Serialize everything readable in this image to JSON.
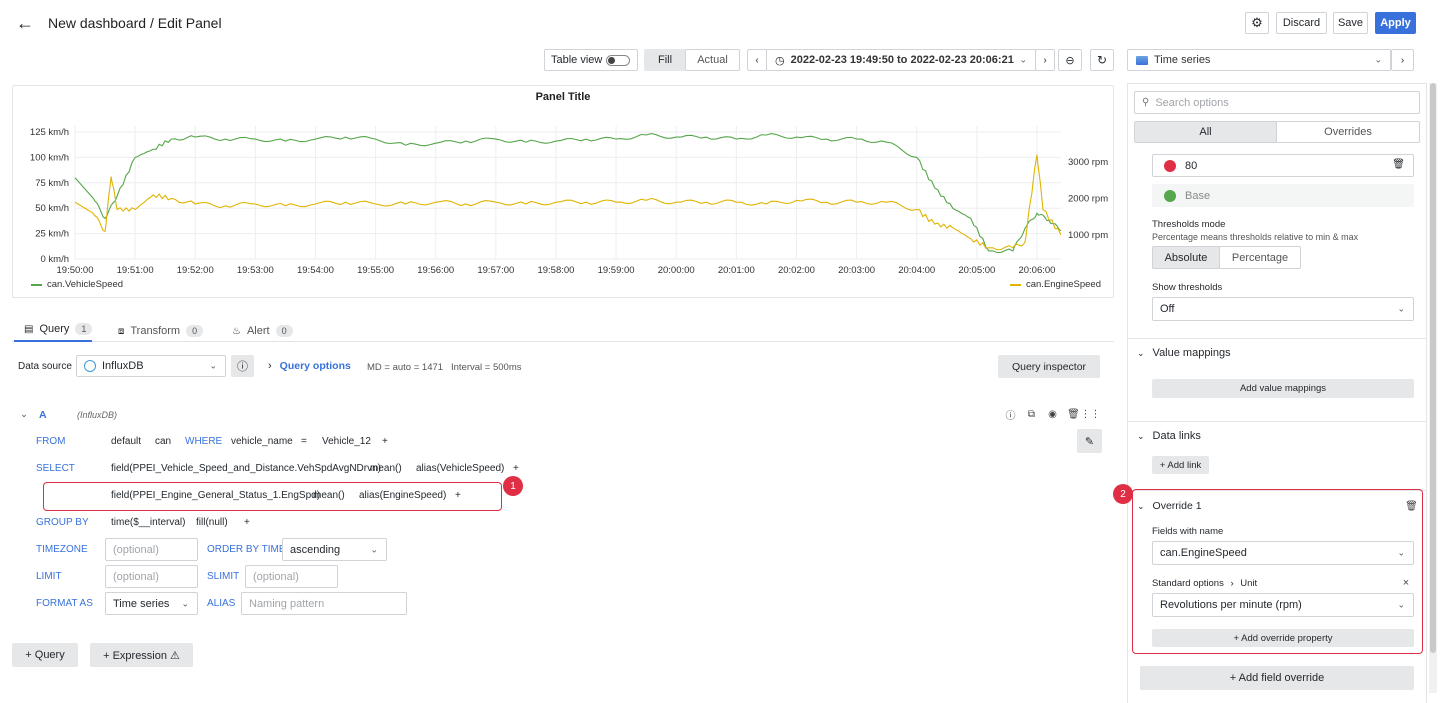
{
  "header": {
    "title": "New dashboard / Edit Panel",
    "discard": "Discard",
    "save": "Save",
    "apply": "Apply"
  },
  "toolbar": {
    "table_view": "Table view",
    "fill": "Fill",
    "actual": "Actual",
    "time_range": "2022-02-23 19:49:50 to 2022-02-23 20:06:21",
    "visualization": "Time series"
  },
  "panel": {
    "title": "Panel Title"
  },
  "chart_data": {
    "type": "line",
    "title": "Panel Title",
    "x": [
      "19:50:00",
      "19:51:00",
      "19:52:00",
      "19:53:00",
      "19:54:00",
      "19:55:00",
      "19:56:00",
      "19:57:00",
      "19:58:00",
      "19:59:00",
      "20:00:00",
      "20:01:00",
      "20:02:00",
      "20:03:00",
      "20:04:00",
      "20:05:00",
      "20:06:00"
    ],
    "y_left_ticks": [
      "125 km/h",
      "100 km/h",
      "75 km/h",
      "50 km/h",
      "25 km/h",
      "0 km/h"
    ],
    "y_right_ticks": [
      "3000 rpm",
      "2000 rpm",
      "1000 rpm"
    ],
    "ylim_left": [
      0,
      125
    ],
    "ylim_right": [
      1000,
      3000
    ],
    "series": [
      {
        "name": "can.VehicleSpeed",
        "color": "#56a64b",
        "axis": "left",
        "points": [
          [
            0,
            80
          ],
          [
            0.3,
            60
          ],
          [
            0.5,
            40
          ],
          [
            0.7,
            62
          ],
          [
            1,
            100
          ],
          [
            1.3,
            108
          ],
          [
            1.6,
            118
          ],
          [
            2,
            120
          ],
          [
            2.5,
            118
          ],
          [
            3,
            118
          ],
          [
            3.5,
            116
          ],
          [
            4,
            118
          ],
          [
            4.5,
            120
          ],
          [
            5,
            118
          ],
          [
            5.5,
            112
          ],
          [
            6,
            114
          ],
          [
            6.5,
            116
          ],
          [
            7,
            118
          ],
          [
            7.5,
            115
          ],
          [
            8,
            116
          ],
          [
            8.5,
            118
          ],
          [
            9,
            118
          ],
          [
            9.5,
            122
          ],
          [
            10,
            120
          ],
          [
            10.5,
            120
          ],
          [
            11,
            118
          ],
          [
            11.5,
            122
          ],
          [
            12,
            120
          ],
          [
            12.5,
            118
          ],
          [
            13,
            118
          ],
          [
            13.5,
            115
          ],
          [
            14,
            100
          ],
          [
            14.3,
            70
          ],
          [
            14.6,
            50
          ],
          [
            14.9,
            40
          ],
          [
            15.2,
            8
          ],
          [
            15.6,
            8
          ],
          [
            15.8,
            30
          ],
          [
            16,
            45
          ],
          [
            16.2,
            38
          ],
          [
            16.4,
            28
          ]
        ]
      },
      {
        "name": "can.EngineSpeed",
        "color": "#e0b400",
        "axis": "right",
        "points": [
          [
            0,
            1900
          ],
          [
            0.3,
            1600
          ],
          [
            0.5,
            1100
          ],
          [
            0.6,
            2600
          ],
          [
            0.7,
            1700
          ],
          [
            1,
            1700
          ],
          [
            1.3,
            2100
          ],
          [
            1.6,
            2000
          ],
          [
            2,
            1850
          ],
          [
            2.5,
            1800
          ],
          [
            3,
            1850
          ],
          [
            3.5,
            1800
          ],
          [
            4,
            1850
          ],
          [
            4.5,
            1900
          ],
          [
            5,
            1850
          ],
          [
            5.5,
            1850
          ],
          [
            6,
            1900
          ],
          [
            6.5,
            1850
          ],
          [
            7,
            1900
          ],
          [
            7.5,
            1850
          ],
          [
            8,
            1900
          ],
          [
            8.5,
            1900
          ],
          [
            9,
            1900
          ],
          [
            9.5,
            1950
          ],
          [
            10,
            1900
          ],
          [
            10.5,
            1900
          ],
          [
            11,
            1900
          ],
          [
            11.5,
            1850
          ],
          [
            12,
            1950
          ],
          [
            12.5,
            1900
          ],
          [
            13,
            1900
          ],
          [
            13.5,
            1900
          ],
          [
            14,
            1700
          ],
          [
            14.3,
            1300
          ],
          [
            14.6,
            1200
          ],
          [
            14.9,
            900
          ],
          [
            15.2,
            650
          ],
          [
            15.6,
            650
          ],
          [
            15.8,
            800
          ],
          [
            15.9,
            2000
          ],
          [
            16,
            3200
          ],
          [
            16.1,
            1700
          ],
          [
            16.4,
            1000
          ]
        ]
      }
    ],
    "legend": [
      "can.VehicleSpeed",
      "can.EngineSpeed"
    ]
  },
  "tabs": {
    "query": "Query",
    "query_count": "1",
    "transform": "Transform",
    "transform_count": "0",
    "alert": "Alert",
    "alert_count": "0"
  },
  "datasource": {
    "label": "Data source",
    "value": "InfluxDB",
    "query_options": "Query options",
    "md": "MD = auto = 1471",
    "interval": "Interval = 500ms",
    "inspector": "Query inspector"
  },
  "query": {
    "ref": "A",
    "ds": "(InfluxDB)",
    "from_kw": "FROM",
    "from_tokens": [
      "default",
      "can",
      "WHERE",
      "vehicle_name",
      "=",
      "Vehicle_12",
      "+"
    ],
    "select_kw": "SELECT",
    "select1": [
      "field(PPEI_Vehicle_Speed_and_Distance.VehSpdAvgNDrvn)",
      "mean()",
      "alias(VehicleSpeed)",
      "+"
    ],
    "select2": [
      "field(PPEI_Engine_General_Status_1.EngSpd)",
      "mean()",
      "alias(EngineSpeed)",
      "+"
    ],
    "groupby_kw": "GROUP BY",
    "groupby_tokens": [
      "time($__interval)",
      "fill(null)",
      "+"
    ],
    "timezone_kw": "TIMEZONE",
    "timezone_ph": "(optional)",
    "orderby_kw": "ORDER BY TIME",
    "orderby_value": "ascending",
    "limit_kw": "LIMIT",
    "limit_ph": "(optional)",
    "slimit_kw": "SLIMIT",
    "slimit_ph": "(optional)",
    "format_kw": "FORMAT AS",
    "format_value": "Time series",
    "alias_kw": "ALIAS",
    "alias_ph": "Naming pattern",
    "badge1": "1"
  },
  "bottom": {
    "add_query": "+ Query",
    "add_expression": "+ Expression ⚠"
  },
  "options": {
    "search_ph": "Search options",
    "all": "All",
    "overrides": "Overrides",
    "threshold_value": "80",
    "threshold_base": "Base",
    "thresholds_mode": "Thresholds mode",
    "thresholds_mode_desc": "Percentage means thresholds relative to min & max",
    "absolute": "Absolute",
    "percentage": "Percentage",
    "show_thresholds": "Show thresholds",
    "show_thresholds_value": "Off",
    "value_mappings": "Value mappings",
    "add_value_mappings": "Add value mappings",
    "data_links": "Data links",
    "add_link": "+ Add link",
    "override_title": "Override 1",
    "fields_with_name": "Fields with name",
    "fields_value": "can.EngineSpeed",
    "std_options": "Standard options",
    "unit": "Unit",
    "unit_value": "Revolutions per minute (rpm)",
    "add_override_property": "+ Add override property",
    "add_field_override": "+ Add field override",
    "badge2": "2"
  },
  "colors": {
    "threshold_red": "#e02f44",
    "threshold_green": "#56a64b",
    "primary": "#3871dc"
  }
}
